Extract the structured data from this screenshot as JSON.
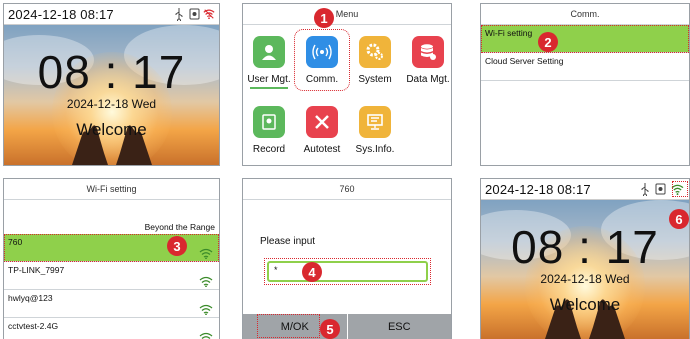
{
  "home": {
    "status_time": "2024-12-18 08:17",
    "clock": "08 : 17",
    "date": "2024-12-18  Wed",
    "welcome": "Welcome",
    "status_icons": [
      "usb-icon",
      "bell-icon",
      "wifi-disconnected-icon"
    ]
  },
  "menu": {
    "title": "Menu",
    "items": [
      {
        "label": "User Mgt.",
        "icon": "user-icon",
        "color": "#5cb85c"
      },
      {
        "label": "Comm.",
        "icon": "signal-icon",
        "color": "#2f8ee5"
      },
      {
        "label": "System",
        "icon": "gears-icon",
        "color": "#f0b43a"
      },
      {
        "label": "Data Mgt.",
        "icon": "database-icon",
        "color": "#e8424e"
      },
      {
        "label": "Record",
        "icon": "record-icon",
        "color": "#5cb85c"
      },
      {
        "label": "Autotest",
        "icon": "tools-icon",
        "color": "#e8424e"
      },
      {
        "label": "Sys.Info.",
        "icon": "monitor-icon",
        "color": "#f0b43a"
      }
    ]
  },
  "comm": {
    "title": "Comm.",
    "items": [
      "Wi-Fi setting",
      "Cloud Server Setting"
    ]
  },
  "wifi": {
    "title": "Wi-Fi setting",
    "note": "Beyond the Range",
    "networks": [
      "760",
      "TP-LINK_7997",
      "hwlyq@123",
      "cctvtest-2.4G"
    ]
  },
  "password": {
    "title": "760",
    "prompt": "Please input",
    "value": "*",
    "ok_label": "M/OK",
    "esc_label": "ESC"
  },
  "home_connected": {
    "status_time": "2024-12-18 08:17",
    "clock": "08 : 17",
    "date": "2024-12-18  Wed",
    "welcome": "Welcome",
    "status_icons": [
      "usb-icon",
      "bell-icon",
      "wifi-connected-icon"
    ]
  },
  "steps": [
    "1",
    "2",
    "3",
    "4",
    "5",
    "6"
  ],
  "colors": {
    "accent_green": "#8fd04b",
    "step_red": "#d9282f",
    "button_gray": "#a0a4a8"
  }
}
